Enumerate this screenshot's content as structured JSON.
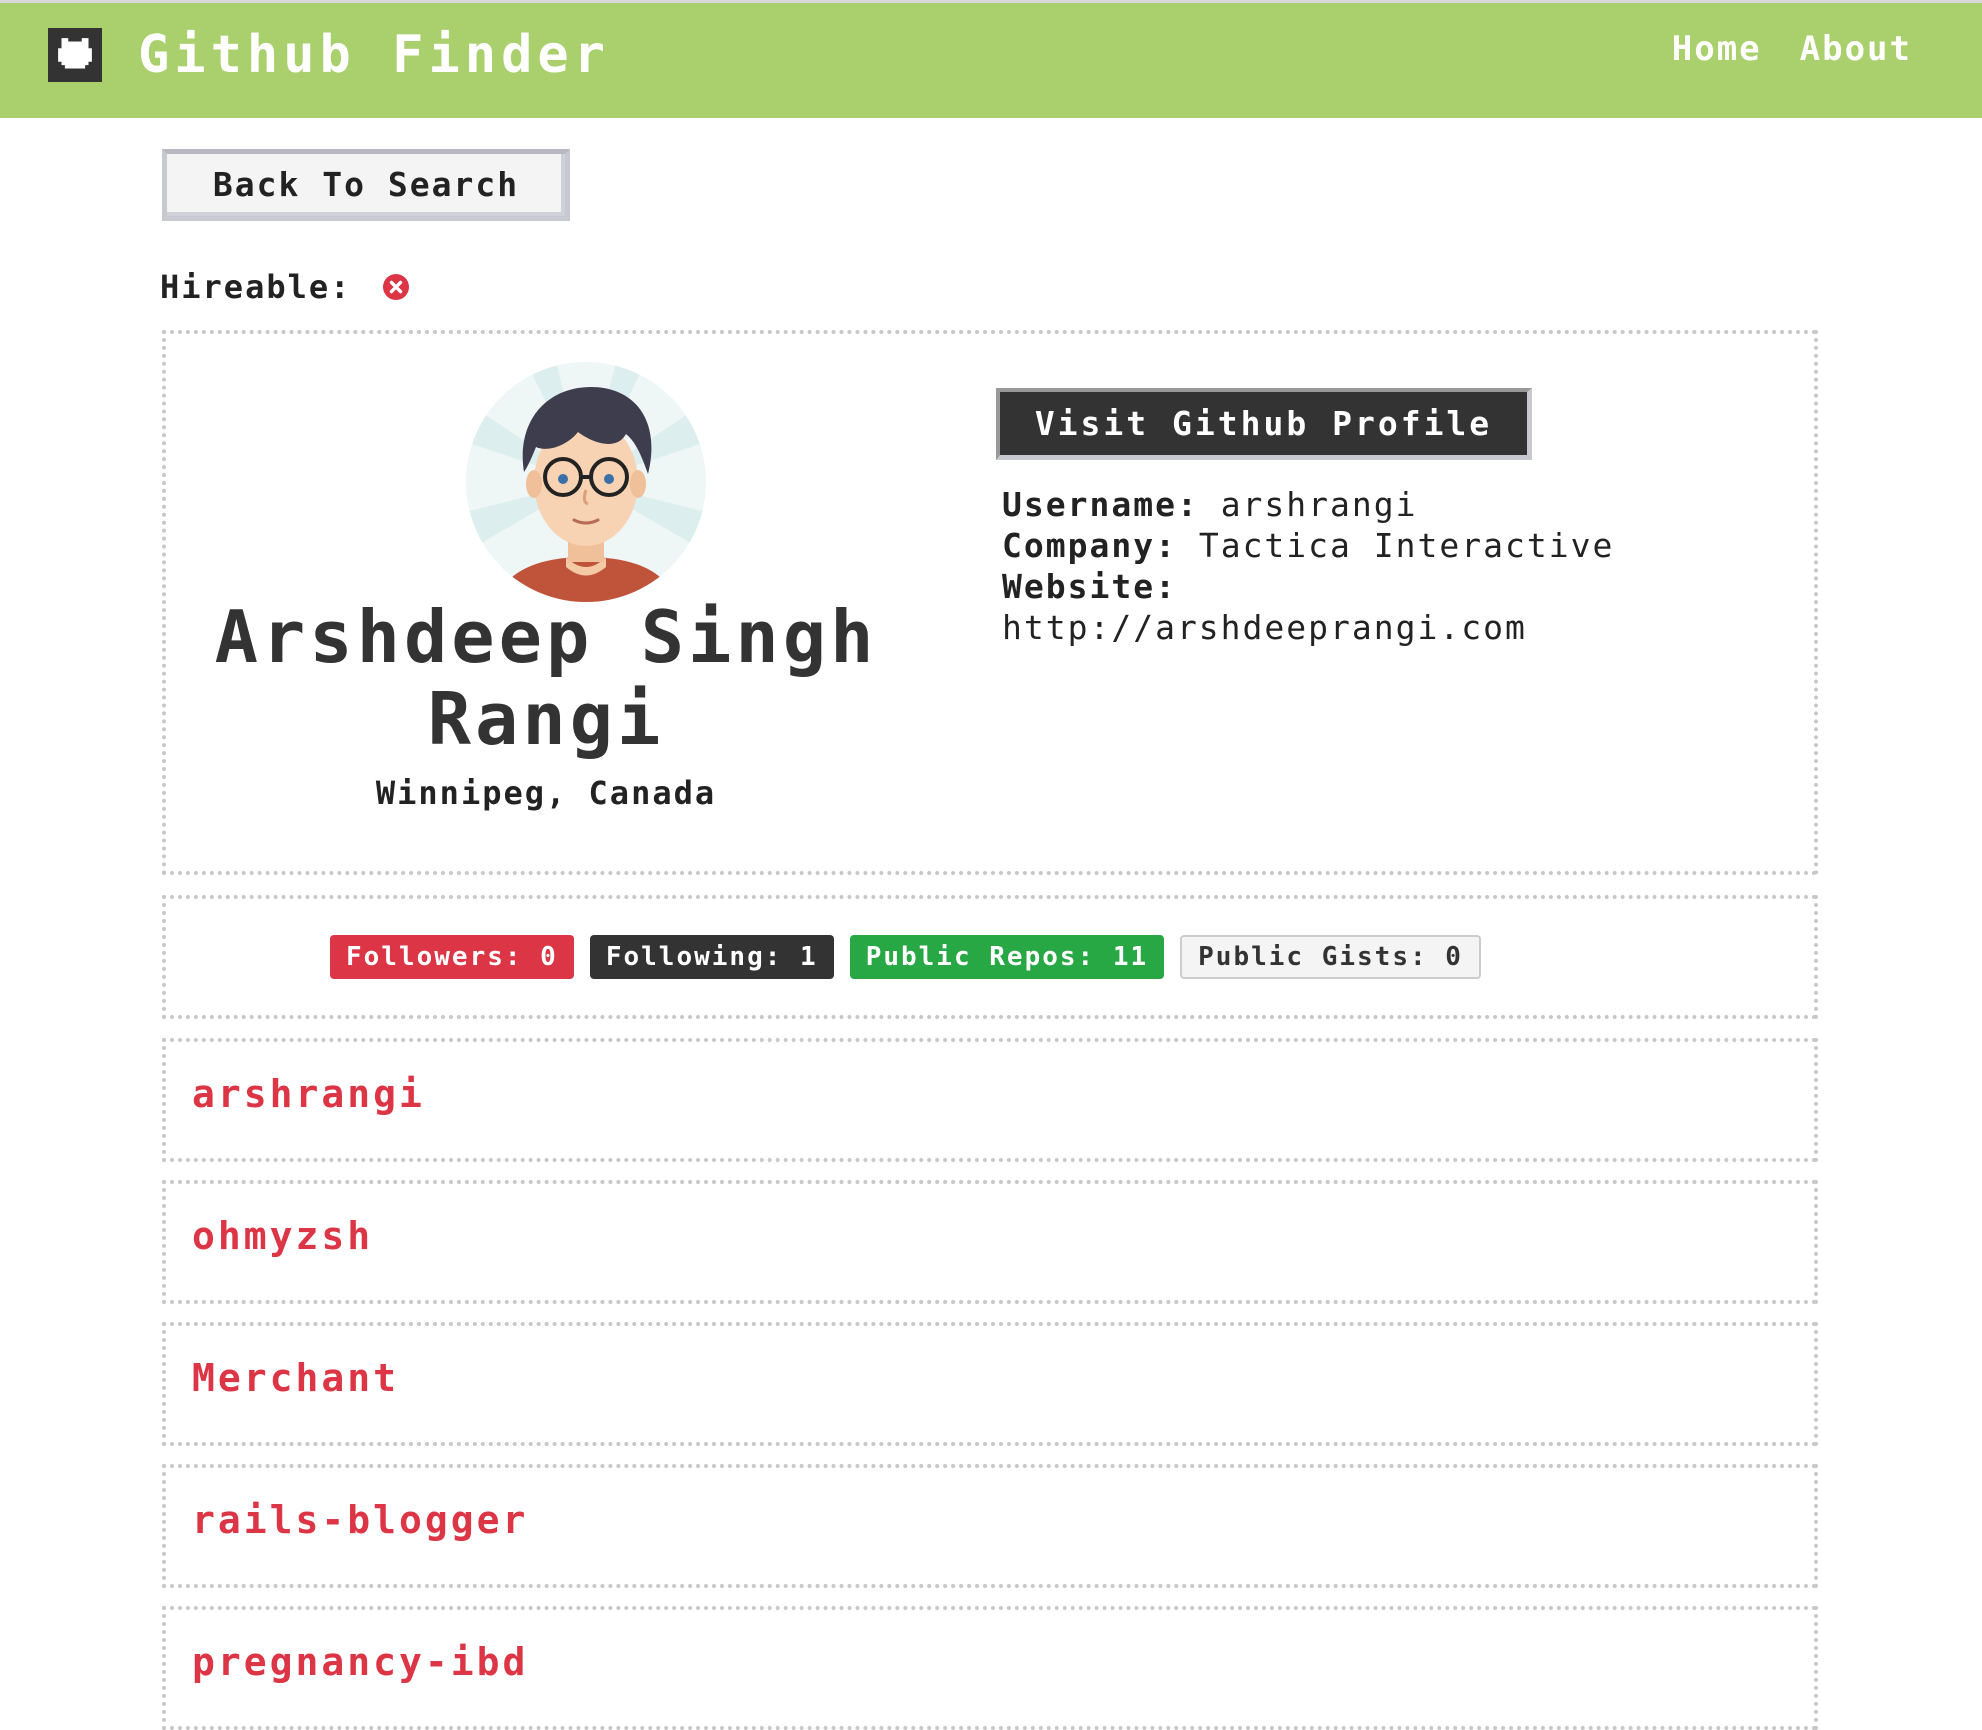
{
  "navbar": {
    "brand_icon": "github-icon",
    "title": "Github Finder",
    "links": [
      "Home",
      "About"
    ],
    "background": "#a9d06d"
  },
  "back_button": {
    "label": "Back To Search"
  },
  "hireable": {
    "label": "Hireable:",
    "status_icon": "times-circle-icon",
    "status_color": "#dc3545"
  },
  "profile": {
    "avatar_icon": "avatar-image",
    "name": "Arshdeep Singh Rangi",
    "location": "Winnipeg, Canada",
    "visit_button": "Visit Github Profile",
    "username_label": "Username:",
    "username": "arshrangi",
    "company_label": "Company:",
    "company": "Tactica Interactive",
    "website_label": "Website:",
    "website": "http://arshdeeprangi.com"
  },
  "stats": {
    "followers": "Followers: 0",
    "following": "Following: 1",
    "public_repos": "Public Repos: 11",
    "public_gists": "Public Gists: 0"
  },
  "repos": [
    "arshrangi",
    "ohmyzsh",
    "Merchant",
    "rails-blogger",
    "pregnancy-ibd"
  ],
  "colors": {
    "red": "#dc3545",
    "dark": "#333333",
    "green": "#28a745",
    "light": "#f4f4f4"
  }
}
